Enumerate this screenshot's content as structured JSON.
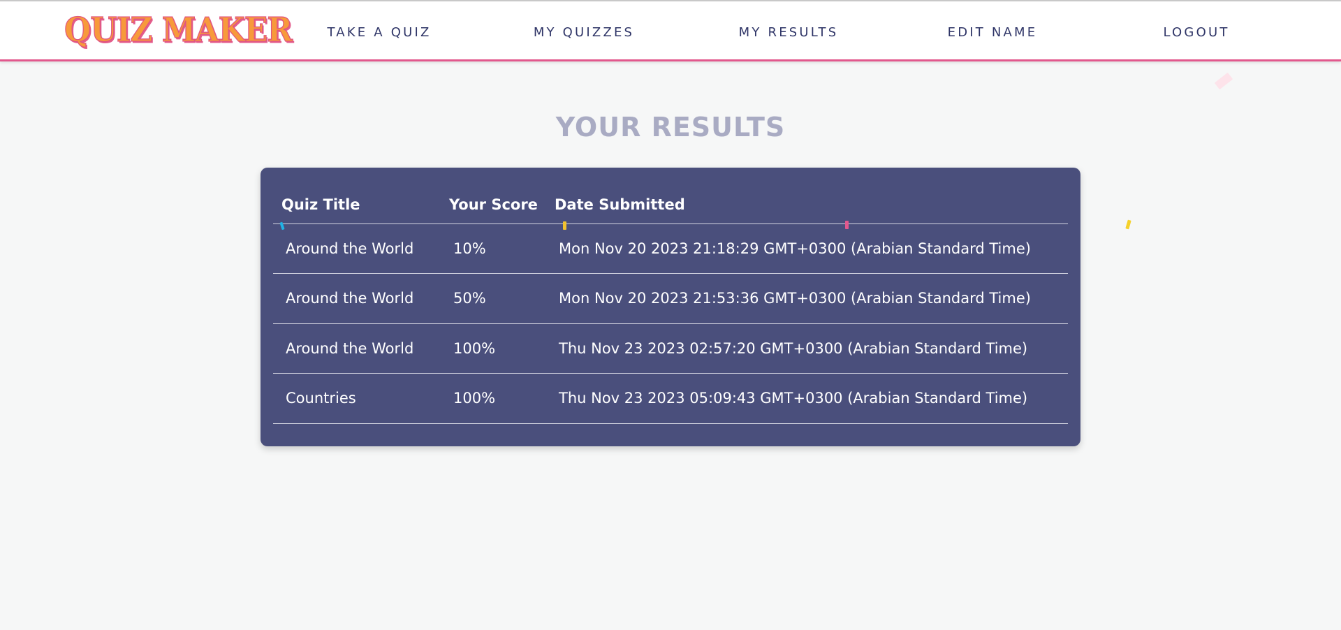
{
  "app": {
    "logo_text": "QUIZ MAKER",
    "colors": {
      "header_border": "#e2588d",
      "logo_fill": "#f79a3b",
      "nav_text": "#2f3567",
      "title_text": "#a9abc3",
      "card_bg": "#4a4f7c",
      "page_bg": "#f6f7f7"
    }
  },
  "nav": {
    "take_quiz": "TAKE A QUIZ",
    "my_quizzes": "MY QUIZZES",
    "my_results": "MY RESULTS",
    "edit_name": "EDIT NAME",
    "logout": "LOGOUT"
  },
  "main": {
    "title": "YOUR RESULTS",
    "table": {
      "headers": [
        "Quiz Title",
        "Your Score",
        "Date Submitted"
      ],
      "rows": [
        [
          "Around the World",
          "10%",
          "Mon Nov 20 2023 21:18:29 GMT+0300 (Arabian Standard Time)"
        ],
        [
          "Around the World",
          "50%",
          "Mon Nov 20 2023 21:53:36 GMT+0300 (Arabian Standard Time)"
        ],
        [
          "Around the World",
          "100%",
          "Thu Nov 23 2023 02:57:20 GMT+0300 (Arabian Standard Time)"
        ],
        [
          "Countries",
          "100%",
          "Thu Nov 23 2023 05:09:43 GMT+0300 (Arabian Standard Time)"
        ]
      ]
    }
  }
}
